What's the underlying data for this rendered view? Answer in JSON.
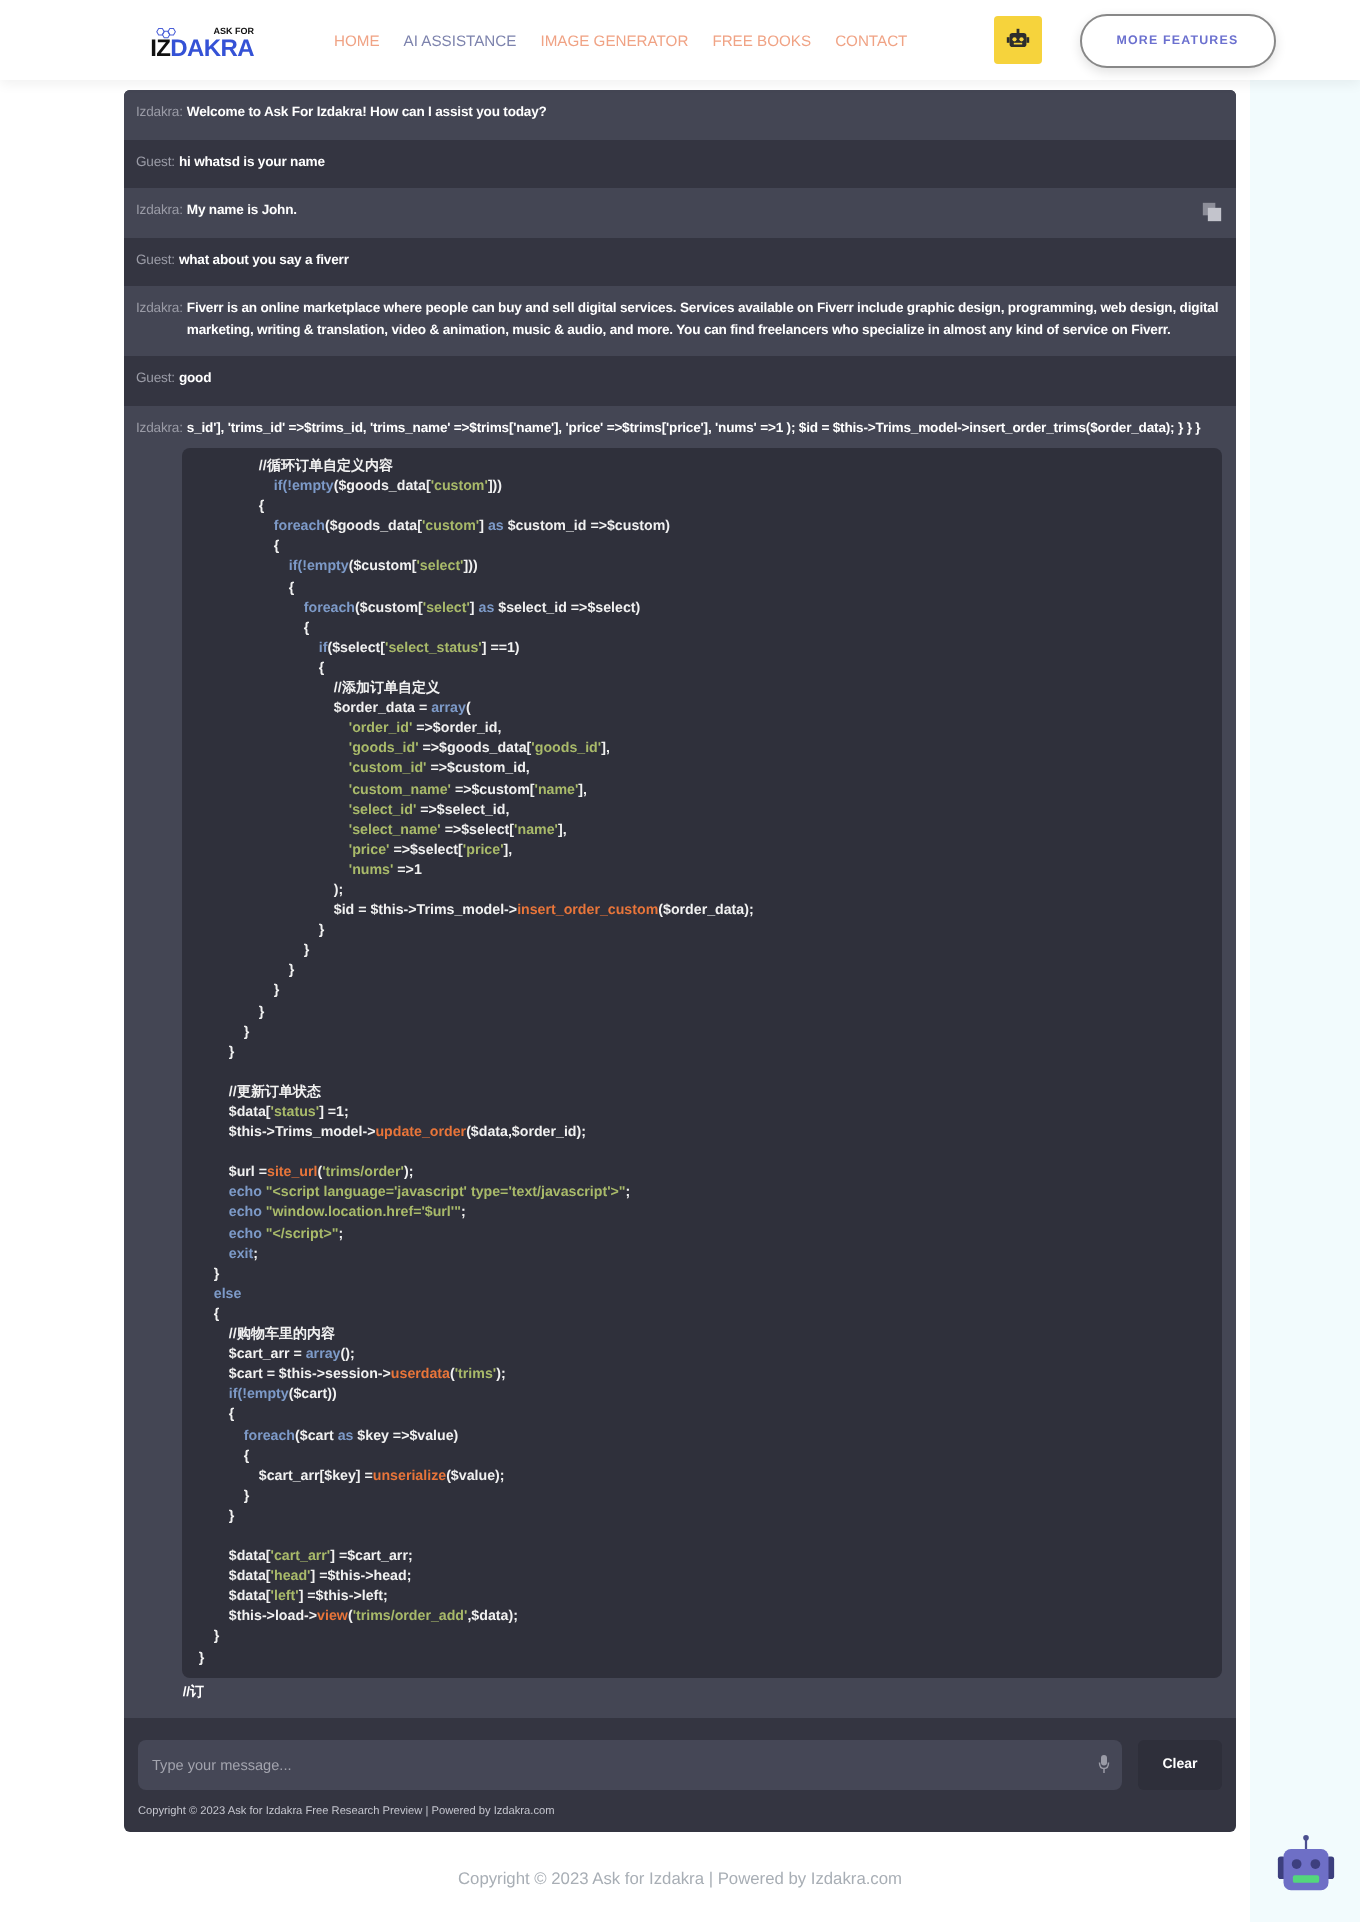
{
  "header": {
    "logo": {
      "tagline": "ASK FOR",
      "wordmark": [
        "IZ",
        "DAKRA"
      ]
    },
    "nav": [
      {
        "label": "HOME",
        "selected": false
      },
      {
        "label": "AI ASSISTANCE",
        "selected": true
      },
      {
        "label": "IMAGE GENERATOR",
        "selected": false
      },
      {
        "label": "FREE BOOKS",
        "selected": false
      },
      {
        "label": "CONTACT",
        "selected": false
      }
    ],
    "features_button": "MORE FEATURES"
  },
  "chat": {
    "messages": [
      {
        "kind": "bot",
        "sender": "Izdakra:",
        "text": "Welcome to Ask For Izdakra! How can I assist you today?",
        "hovered": false
      },
      {
        "kind": "guest",
        "sender": "Guest:",
        "text": "hi whatsd is your name",
        "hovered": false
      },
      {
        "kind": "bot",
        "sender": "Izdakra:",
        "text": "My name is John.",
        "hovered": true
      },
      {
        "kind": "guest",
        "sender": "Guest:",
        "text": "what about you say a fiverr",
        "hovered": false
      },
      {
        "kind": "bot",
        "sender": "Izdakra:",
        "text": "Fiverr is an online marketplace where people can buy and sell digital services. Services available on Fiverr include graphic design, programming, web design, digital marketing, writing & translation, video & animation, music & audio, and more. You can find freelancers who specialize in almost any kind of service on Fiverr.",
        "hovered": false
      },
      {
        "kind": "guest",
        "sender": "Guest:",
        "text": "good",
        "hovered": false
      },
      {
        "kind": "bot",
        "sender": "Izdakra:",
        "text": "s_id'], 'trims_id' =>$trims_id, 'trims_name' =>$trims['name'], 'price' =>$trims['price'], 'nums' =>1 ); $id = $this->Trims_model->insert_order_trims($order_data); } } }",
        "hovered": false,
        "tail": "//订",
        "code_lines": [
          [
            {
              "kind": "plain",
              "text": "\t\t\t\t//循环订单自定义内容"
            }
          ],
          [
            {
              "kind": "keyword",
              "text": "\t\t\t\t\tif(!empty"
            },
            {
              "kind": "plain",
              "text": "($goods_data["
            },
            {
              "kind": "string",
              "text": "'custom'"
            },
            {
              "kind": "plain",
              "text": "]))"
            }
          ],
          [
            {
              "kind": "plain",
              "text": "\t\t\t\t{"
            }
          ],
          [
            {
              "kind": "keyword",
              "text": "\t\t\t\t\tforeach"
            },
            {
              "kind": "plain",
              "text": "($goods_data["
            },
            {
              "kind": "string",
              "text": "'custom'"
            },
            {
              "kind": "plain",
              "text": "] "
            },
            {
              "kind": "keyword",
              "text": "as"
            },
            {
              "kind": "plain",
              "text": " $custom_id =>$custom)"
            }
          ],
          [
            {
              "kind": "plain",
              "text": "\t\t\t\t\t{"
            }
          ],
          [
            {
              "kind": "keyword",
              "text": "\t\t\t\t\t\tif(!empty"
            },
            {
              "kind": "plain",
              "text": "($custom["
            },
            {
              "kind": "string",
              "text": "'select'"
            },
            {
              "kind": "plain",
              "text": "]))"
            }
          ],
          [
            {
              "kind": "plain",
              "text": "\t\t\t\t\t\t{"
            }
          ],
          [
            {
              "kind": "keyword",
              "text": "\t\t\t\t\t\t\tforeach"
            },
            {
              "kind": "plain",
              "text": "($custom["
            },
            {
              "kind": "string",
              "text": "'select'"
            },
            {
              "kind": "plain",
              "text": "] "
            },
            {
              "kind": "keyword",
              "text": "as"
            },
            {
              "kind": "plain",
              "text": " $select_id =>$select)"
            }
          ],
          [
            {
              "kind": "plain",
              "text": "\t\t\t\t\t\t\t{"
            }
          ],
          [
            {
              "kind": "keyword",
              "text": "\t\t\t\t\t\t\t\tif"
            },
            {
              "kind": "plain",
              "text": "($select["
            },
            {
              "kind": "string",
              "text": "'select_status'"
            },
            {
              "kind": "plain",
              "text": "] ==1)"
            }
          ],
          [
            {
              "kind": "plain",
              "text": "\t\t\t\t\t\t\t\t{"
            }
          ],
          [
            {
              "kind": "plain",
              "text": "\t\t\t\t\t\t\t\t\t//添加订单自定义"
            }
          ],
          [
            {
              "kind": "plain",
              "text": "\t\t\t\t\t\t\t\t\t$order_data = "
            },
            {
              "kind": "keyword",
              "text": "array"
            },
            {
              "kind": "plain",
              "text": "("
            }
          ],
          [
            {
              "kind": "string",
              "text": "\t\t\t\t\t\t\t\t\t\t'order_id'"
            },
            {
              "kind": "plain",
              "text": " =>$order_id,"
            }
          ],
          [
            {
              "kind": "string",
              "text": "\t\t\t\t\t\t\t\t\t\t'goods_id'"
            },
            {
              "kind": "plain",
              "text": " =>$goods_data["
            },
            {
              "kind": "string",
              "text": "'goods_id'"
            },
            {
              "kind": "plain",
              "text": "],"
            }
          ],
          [
            {
              "kind": "string",
              "text": "\t\t\t\t\t\t\t\t\t\t'custom_id'"
            },
            {
              "kind": "plain",
              "text": " =>$custom_id,"
            }
          ],
          [
            {
              "kind": "string",
              "text": "\t\t\t\t\t\t\t\t\t\t'custom_name'"
            },
            {
              "kind": "plain",
              "text": " =>$custom["
            },
            {
              "kind": "string",
              "text": "'name'"
            },
            {
              "kind": "plain",
              "text": "],"
            }
          ],
          [
            {
              "kind": "string",
              "text": "\t\t\t\t\t\t\t\t\t\t'select_id'"
            },
            {
              "kind": "plain",
              "text": " =>$select_id,"
            }
          ],
          [
            {
              "kind": "string",
              "text": "\t\t\t\t\t\t\t\t\t\t'select_name'"
            },
            {
              "kind": "plain",
              "text": " =>$select["
            },
            {
              "kind": "string",
              "text": "'name'"
            },
            {
              "kind": "plain",
              "text": "],"
            }
          ],
          [
            {
              "kind": "string",
              "text": "\t\t\t\t\t\t\t\t\t\t'price'"
            },
            {
              "kind": "plain",
              "text": " =>$select["
            },
            {
              "kind": "string",
              "text": "'price'"
            },
            {
              "kind": "plain",
              "text": "],"
            }
          ],
          [
            {
              "kind": "string",
              "text": "\t\t\t\t\t\t\t\t\t\t'nums'"
            },
            {
              "kind": "plain",
              "text": " =>1"
            }
          ],
          [
            {
              "kind": "plain",
              "text": "\t\t\t\t\t\t\t\t\t);"
            }
          ],
          [
            {
              "kind": "plain",
              "text": "\t\t\t\t\t\t\t\t\t$id = $this->Trims_model->"
            },
            {
              "kind": "function",
              "text": "insert_order_custom"
            },
            {
              "kind": "plain",
              "text": "($order_data);"
            }
          ],
          [
            {
              "kind": "plain",
              "text": "\t\t\t\t\t\t\t\t}"
            }
          ],
          [
            {
              "kind": "plain",
              "text": "\t\t\t\t\t\t\t}"
            }
          ],
          [
            {
              "kind": "plain",
              "text": "\t\t\t\t\t\t}"
            }
          ],
          [
            {
              "kind": "plain",
              "text": "\t\t\t\t\t}"
            }
          ],
          [
            {
              "kind": "plain",
              "text": "\t\t\t\t}"
            }
          ],
          [
            {
              "kind": "plain",
              "text": "\t\t\t}"
            }
          ],
          [
            {
              "kind": "plain",
              "text": "\t\t}"
            }
          ],
          [
            {
              "kind": "blank"
            }
          ],
          [
            {
              "kind": "plain",
              "text": "\t\t//更新订单状态"
            }
          ],
          [
            {
              "kind": "plain",
              "text": "\t\t$data["
            },
            {
              "kind": "string",
              "text": "'status'"
            },
            {
              "kind": "plain",
              "text": "] =1;"
            }
          ],
          [
            {
              "kind": "plain",
              "text": "\t\t$this->Trims_model->"
            },
            {
              "kind": "function",
              "text": "update_order"
            },
            {
              "kind": "plain",
              "text": "($data,$order_id);"
            }
          ],
          [
            {
              "kind": "blank"
            }
          ],
          [
            {
              "kind": "plain",
              "text": "\t\t$url ="
            },
            {
              "kind": "function",
              "text": "site_url"
            },
            {
              "kind": "plain",
              "text": "("
            },
            {
              "kind": "string",
              "text": "'trims/order'"
            },
            {
              "kind": "plain",
              "text": ");"
            }
          ],
          [
            {
              "kind": "keyword",
              "text": "\t\techo"
            },
            {
              "kind": "string",
              "text": " \"<script language='javascript' type='text/javascript'>\""
            },
            {
              "kind": "plain",
              "text": ";"
            }
          ],
          [
            {
              "kind": "keyword",
              "text": "\t\techo"
            },
            {
              "kind": "string",
              "text": " \"window.location.href='$url'\""
            },
            {
              "kind": "plain",
              "text": ";"
            }
          ],
          [
            {
              "kind": "keyword",
              "text": "\t\techo"
            },
            {
              "kind": "string",
              "text": " \"</script>\""
            },
            {
              "kind": "plain",
              "text": ";"
            }
          ],
          [
            {
              "kind": "keyword",
              "text": "\t\texit"
            },
            {
              "kind": "plain",
              "text": ";"
            }
          ],
          [
            {
              "kind": "plain",
              "text": "\t}"
            }
          ],
          [
            {
              "kind": "keyword",
              "text": "\telse"
            }
          ],
          [
            {
              "kind": "plain",
              "text": "\t{"
            }
          ],
          [
            {
              "kind": "plain",
              "text": "\t\t//购物车里的内容"
            }
          ],
          [
            {
              "kind": "plain",
              "text": "\t\t$cart_arr = "
            },
            {
              "kind": "keyword",
              "text": "array"
            },
            {
              "kind": "plain",
              "text": "();"
            }
          ],
          [
            {
              "kind": "plain",
              "text": "\t\t$cart = $this->session->"
            },
            {
              "kind": "function",
              "text": "userdata"
            },
            {
              "kind": "plain",
              "text": "("
            },
            {
              "kind": "string",
              "text": "'trims'"
            },
            {
              "kind": "plain",
              "text": ");"
            }
          ],
          [
            {
              "kind": "keyword",
              "text": "\t\tif(!empty"
            },
            {
              "kind": "plain",
              "text": "($cart))"
            }
          ],
          [
            {
              "kind": "plain",
              "text": "\t\t{"
            }
          ],
          [
            {
              "kind": "keyword",
              "text": "\t\t\tforeach"
            },
            {
              "kind": "plain",
              "text": "($cart "
            },
            {
              "kind": "keyword",
              "text": "as"
            },
            {
              "kind": "plain",
              "text": " $key =>$value)"
            }
          ],
          [
            {
              "kind": "plain",
              "text": "\t\t\t{"
            }
          ],
          [
            {
              "kind": "plain",
              "text": "\t\t\t\t$cart_arr[$key] ="
            },
            {
              "kind": "function",
              "text": "unserialize"
            },
            {
              "kind": "plain",
              "text": "($value);"
            }
          ],
          [
            {
              "kind": "plain",
              "text": "\t\t\t}"
            }
          ],
          [
            {
              "kind": "plain",
              "text": "\t\t}"
            }
          ],
          [
            {
              "kind": "blank"
            }
          ],
          [
            {
              "kind": "plain",
              "text": "\t\t$data["
            },
            {
              "kind": "string",
              "text": "'cart_arr'"
            },
            {
              "kind": "plain",
              "text": "] =$cart_arr;"
            }
          ],
          [
            {
              "kind": "plain",
              "text": "\t\t$data["
            },
            {
              "kind": "string",
              "text": "'head'"
            },
            {
              "kind": "plain",
              "text": "] =$this->head;"
            }
          ],
          [
            {
              "kind": "plain",
              "text": "\t\t$data["
            },
            {
              "kind": "string",
              "text": "'left'"
            },
            {
              "kind": "plain",
              "text": "] =$this->left;"
            }
          ],
          [
            {
              "kind": "plain",
              "text": "\t\t$this->load->"
            },
            {
              "kind": "function",
              "text": "view"
            },
            {
              "kind": "plain",
              "text": "("
            },
            {
              "kind": "string",
              "text": "'trims/order_add'"
            },
            {
              "kind": "plain",
              "text": ",$data);"
            }
          ],
          [
            {
              "kind": "plain",
              "text": "\t}"
            }
          ],
          [
            {
              "kind": "plain",
              "text": "}"
            }
          ]
        ]
      }
    ],
    "input": {
      "placeholder": "Type your message..."
    },
    "clear_button": "Clear",
    "copyright": "Copyright © 2023 Ask for Izdakra Free Research Preview | Powered by Izdakra.com"
  },
  "footer": "Copyright © 2023 Ask for Izdakra | Powered by Izdakra.com"
}
